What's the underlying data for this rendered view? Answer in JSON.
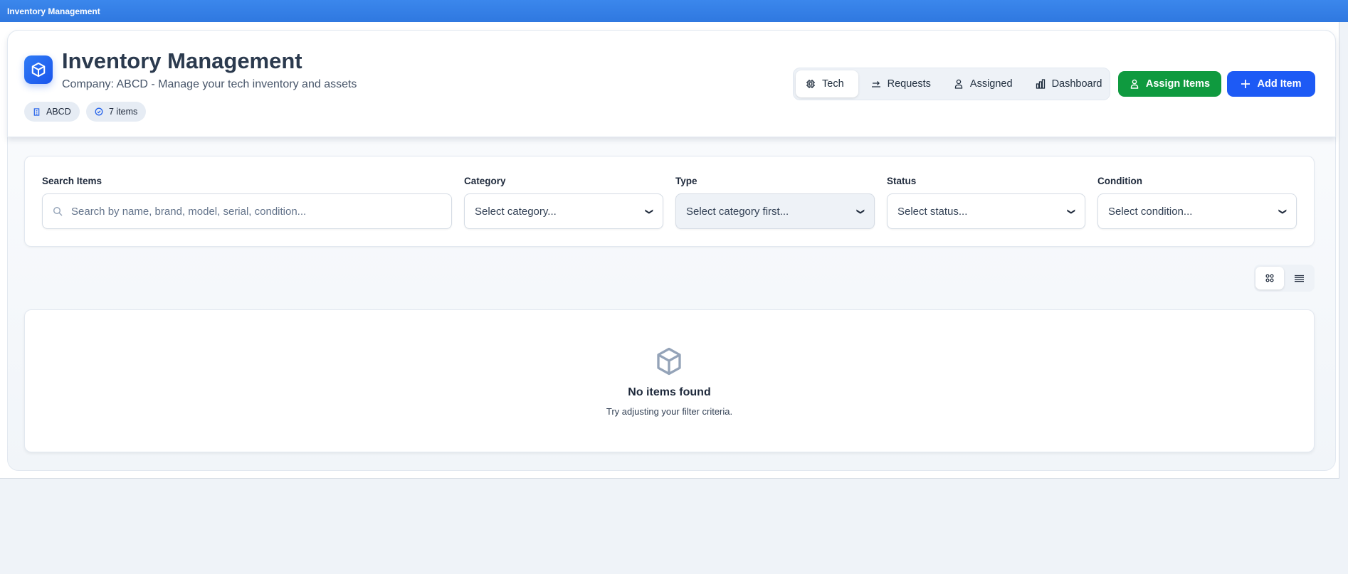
{
  "window": {
    "title": "Inventory Management"
  },
  "header": {
    "title": "Inventory Management",
    "subtitle": "Company: ABCD - Manage your tech inventory and assets",
    "badges": [
      {
        "label": "ABCD",
        "icon": "building-icon"
      },
      {
        "label": "7 items",
        "icon": "check-circle-icon"
      }
    ]
  },
  "tabs": [
    {
      "label": "Tech",
      "icon": "cpu-icon",
      "active": true
    },
    {
      "label": "Requests",
      "icon": "arrow-right-icon"
    },
    {
      "label": "Assigned",
      "icon": "user-icon"
    },
    {
      "label": "Dashboard",
      "icon": "bar-chart-icon"
    }
  ],
  "actions": {
    "assign": "Assign Items",
    "add": "Add Item"
  },
  "filters": {
    "search_label": "Search Items",
    "search_placeholder": "Search by name, brand, model, serial, condition...",
    "category_label": "Category",
    "category_value": "Select category...",
    "type_label": "Type",
    "type_value": "Select category first...",
    "status_label": "Status",
    "status_value": "Select status...",
    "condition_label": "Condition",
    "condition_value": "Select condition..."
  },
  "view": {
    "active": "grid"
  },
  "empty": {
    "title": "No items found",
    "message": "Try adjusting your filter criteria."
  },
  "colors": {
    "primary": "#1d5af5",
    "success": "#0f9a3f",
    "titlebar": "#3b87ec"
  }
}
